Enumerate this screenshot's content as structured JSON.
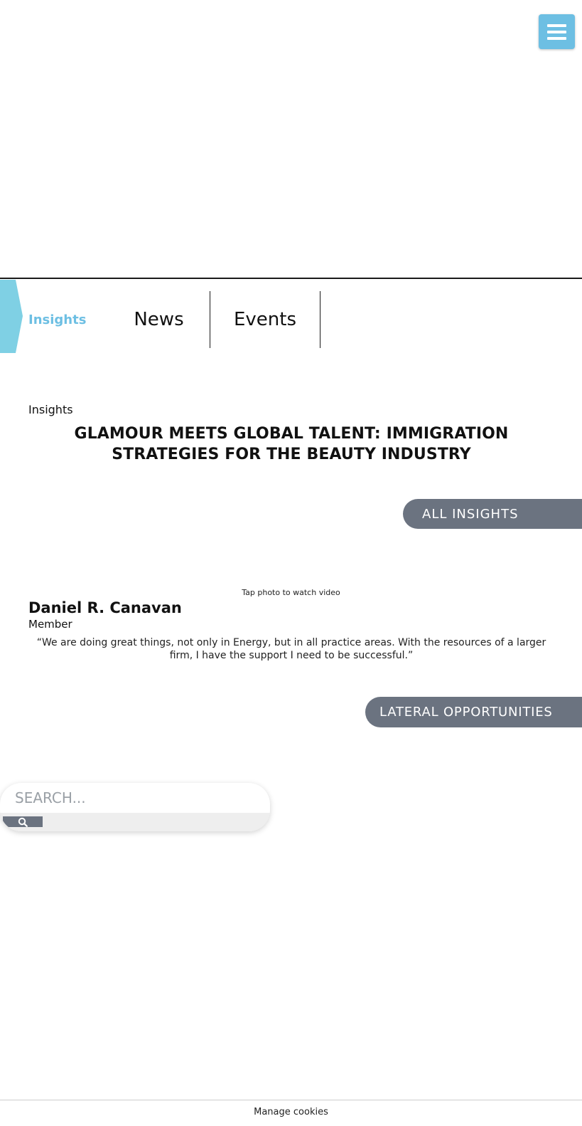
{
  "header": {
    "menu_icon": "hamburger-menu-icon",
    "accent_color": "#6dbfe3"
  },
  "tabs": [
    {
      "label": "Insights",
      "active": true
    },
    {
      "label": "News",
      "active": false
    },
    {
      "label": "Events",
      "active": false
    }
  ],
  "article": {
    "category": "Insights",
    "title": "GLAMOUR MEETS GLOBAL TALENT: IMMIGRATION STRATEGIES FOR THE BEAUTY INDUSTRY",
    "all_button": "ALL INSIGHTS"
  },
  "testimonial": {
    "caption": "Tap photo to watch video",
    "name": "Daniel R. Canavan",
    "role": "Member",
    "quote": "“We are doing great things, not only in Energy, but in all practice areas. With the resources of a larger firm, I have the support I need to be successful.”",
    "cta": "LATERAL OPPORTUNITIES"
  },
  "search": {
    "placeholder": "SEARCH...",
    "button_icon": "search-icon"
  },
  "footer": {
    "manage_cookies": "Manage cookies"
  },
  "colors": {
    "button_gray": "#6b7380",
    "accent": "#6dbfe3"
  }
}
